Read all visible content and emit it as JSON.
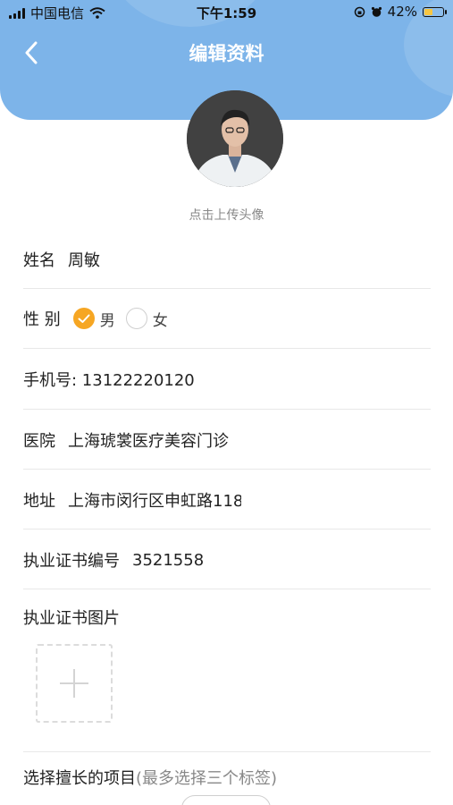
{
  "status_bar": {
    "carrier": "中国电信",
    "time": "下午1:59",
    "battery": "42%",
    "battery_level": 0.42
  },
  "header": {
    "title": "编辑资料",
    "back_icon": "chevron-left-icon",
    "background_color": "#7db4e9"
  },
  "avatar": {
    "hint": "点击上传头像"
  },
  "form": {
    "name": {
      "label": "姓名",
      "value": "周敏"
    },
    "gender": {
      "label": "性 别",
      "options": [
        "男",
        "女"
      ],
      "selected": "男"
    },
    "phone": {
      "label": "手机号: 13122220120"
    },
    "hospital": {
      "label": "医院",
      "value": "上海琥裳医疗美容门诊"
    },
    "address": {
      "label": "地址",
      "value": "上海市闵行区申虹路118"
    },
    "license_no": {
      "label": "执业证书编号",
      "value": "3521558"
    },
    "license_image": {
      "label": "执业证书图片"
    },
    "specialty": {
      "label": "选择擅长的项目",
      "hint": "(最多选择三个标签)"
    }
  },
  "accent_color": "#f6a623"
}
